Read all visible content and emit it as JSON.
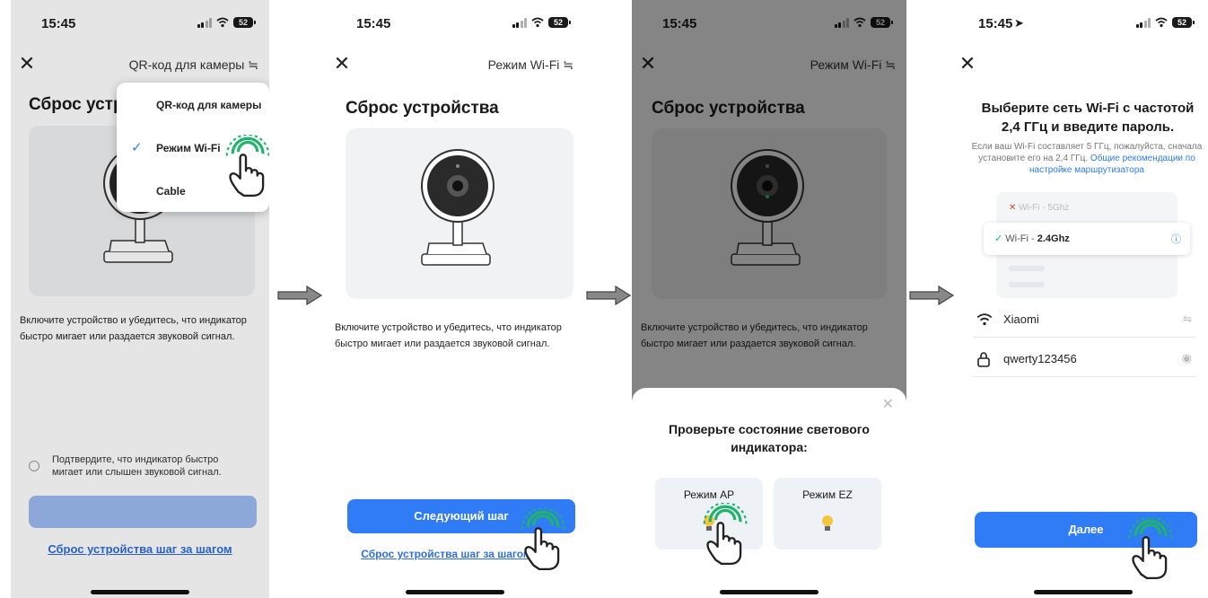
{
  "colors": {
    "accent": "#2f7cf6",
    "green_tap": "#1fb36b",
    "overlay": "rgba(0,0,0,0.48)"
  },
  "screens": [
    {
      "status": {
        "time": "15:45",
        "battery": "52"
      },
      "header": {
        "right_label": "QR-код для камеры ≒"
      },
      "title": "Сброс устро",
      "dropdown": {
        "items": [
          "QR-код для камеры",
          "Режим Wi-Fi",
          "Cable"
        ],
        "selected": "Режим Wi-Fi"
      },
      "description": "Включите устройство и убедитесь, что индикатор быстро мигает или раздается звуковой сигнал.",
      "confirm_text": "Подтвердите, что индикатор быстро мигает или слышен звуковой сигнал.",
      "primary_button": "",
      "link": "Сброс устройства шаг за шагом"
    },
    {
      "status": {
        "time": "15:45",
        "battery": "52"
      },
      "header": {
        "right_label": "Режим Wi-Fi ≒"
      },
      "title": "Сброс устройства",
      "description": "Включите устройство и убедитесь, что индикатор быстро мигает или раздается звуковой сигнал.",
      "primary_button": "Следующий шаг",
      "link": "Сброс устройства шаг за шагом"
    },
    {
      "status": {
        "time": "15:45",
        "battery": "52"
      },
      "header": {
        "right_label": "Режим Wi-Fi ≒"
      },
      "title": "Сброс устройства",
      "description": "Включите устройство и убедитесь, что индикатор быстро мигает или раздается звуковой сигнал.",
      "sheet": {
        "title": "Проверьте состояние светового индикатора:",
        "options": [
          "Режим AP",
          "Режим EZ"
        ]
      }
    },
    {
      "status": {
        "time": "15:45",
        "battery": "52"
      },
      "title": "Выберите сеть Wi-Fi с частотой 2,4 ГГц и введите пароль.",
      "description": "Если ваш Wi-Fi составляет 5 ГГц, пожалуйста, сначала установите его на 2,4 ГГц.",
      "description_link": "Общие рекомендации по настройке маршрутизатора",
      "networks": [
        {
          "prefix": "Wi-Fi - ",
          "name": "5Ghz",
          "ok": false
        },
        {
          "prefix": "Wi-Fi - ",
          "name": "2.4Ghz",
          "ok": true
        }
      ],
      "ssid": "Xiaomi",
      "password": "qwerty123456",
      "primary_button": "Далее"
    }
  ]
}
